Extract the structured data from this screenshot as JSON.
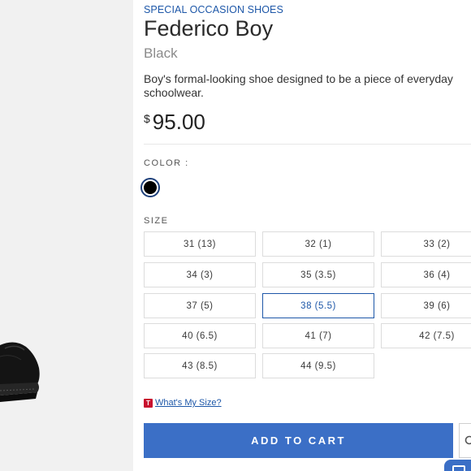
{
  "product": {
    "category": "SPECIAL OCCASION SHOES",
    "name": "Federico Boy",
    "color_name": "Black",
    "description": "Boy's formal-looking shoe designed to be a piece of everyday schoolwear.",
    "currency_symbol": "$",
    "price": "95.00"
  },
  "color_section": {
    "label": "COLOR :",
    "swatches": [
      {
        "name": "Black",
        "hex": "#000000",
        "selected": true
      }
    ]
  },
  "size_section": {
    "label": "SIZE",
    "sizes": [
      {
        "label": "31 (13)",
        "selected": false
      },
      {
        "label": "32 (1)",
        "selected": false
      },
      {
        "label": "33 (2)",
        "selected": false
      },
      {
        "label": "34 (3)",
        "selected": false
      },
      {
        "label": "35 (3.5)",
        "selected": false
      },
      {
        "label": "36 (4)",
        "selected": false
      },
      {
        "label": "37 (5)",
        "selected": false
      },
      {
        "label": "38 (5.5)",
        "selected": true
      },
      {
        "label": "39 (6)",
        "selected": false
      },
      {
        "label": "40 (6.5)",
        "selected": false
      },
      {
        "label": "41 (7)",
        "selected": false
      },
      {
        "label": "42 (7.5)",
        "selected": false
      },
      {
        "label": "43 (8.5)",
        "selected": false
      },
      {
        "label": "44 (9.5)",
        "selected": false
      }
    ],
    "help_icon_letter": "T",
    "help_link": "What's My Size?"
  },
  "actions": {
    "add_to_cart": "ADD TO CART",
    "side_icon": "search-icon",
    "corner_icon": "chat-icon"
  },
  "colors": {
    "accent": "#1d57a8",
    "button": "#3b6fc6",
    "brand_red": "#c8102e",
    "panel_bg": "#f1f1f1"
  }
}
